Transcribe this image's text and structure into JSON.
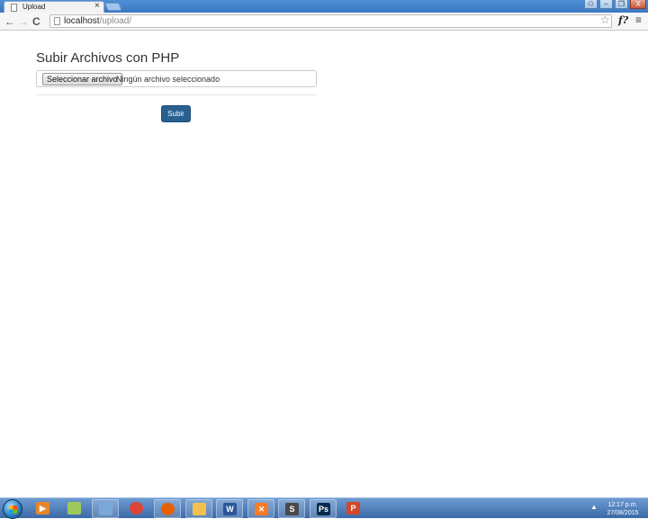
{
  "browser": {
    "tab_title": "Upload",
    "tab_close": "×",
    "url_host": "localhost",
    "url_path": "/upload/",
    "nav_back": "←",
    "nav_forward": "→",
    "nav_reload": "C",
    "star_glyph": "☆",
    "extension_label": "f?",
    "menu_glyph": "≡",
    "window_controls": {
      "user": "⚇",
      "minimize": "–",
      "maximize": "❐",
      "close": "X"
    }
  },
  "page": {
    "title": "Subir Archivos con PHP",
    "file_button_label": "Seleccionar archivo",
    "file_status": "Ningún archivo seleccionado",
    "submit_label": "Subir"
  },
  "taskbar": {
    "apps": [
      {
        "name": "media-player-icon",
        "glyph": "▶",
        "color": "#e8872a"
      },
      {
        "name": "folder-sync-icon",
        "glyph": "",
        "color": "#9ec95a"
      },
      {
        "name": "file-manager-icon",
        "glyph": "",
        "color": "#7aa8d8"
      },
      {
        "name": "chrome-icon",
        "glyph": "",
        "color": "#db4437"
      },
      {
        "name": "firefox-icon",
        "glyph": "",
        "color": "#e66000"
      },
      {
        "name": "explorer-folder-icon",
        "glyph": "",
        "color": "#f3c14b"
      },
      {
        "name": "word-icon",
        "glyph": "W",
        "color": "#2b579a"
      },
      {
        "name": "xampp-icon",
        "glyph": "✕",
        "color": "#fb7a24"
      },
      {
        "name": "sublime-icon",
        "glyph": "S",
        "color": "#4a4a4a"
      },
      {
        "name": "photoshop-icon",
        "glyph": "Ps",
        "color": "#0a2a4d"
      },
      {
        "name": "powerpoint-icon",
        "glyph": "P",
        "color": "#d24726"
      }
    ],
    "tray_arrow": "▲",
    "clock_time": "12:17 p.m.",
    "clock_date": "27/08/2015"
  }
}
